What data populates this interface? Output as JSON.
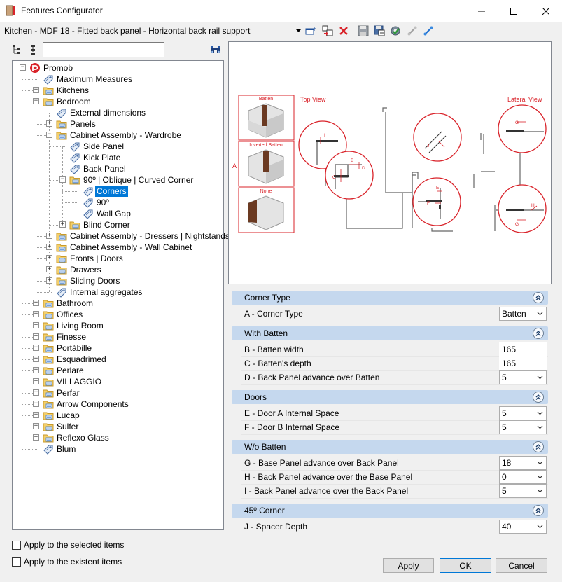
{
  "window": {
    "title": "Features Configurator",
    "controls": {
      "minimize": "minimize",
      "maximize": "maximize",
      "close": "close"
    }
  },
  "toolbar": {
    "configuration": "Kitchen - MDF 18 - Fitted back panel - Horizontal back rail support",
    "buttons": [
      "add-config-icon",
      "copy-config-icon",
      "delete-icon",
      "save-icon",
      "save-as-icon",
      "settings-icon",
      "link-gray-icon",
      "link-blue-icon"
    ]
  },
  "tree_toolbar": {
    "search_value": ""
  },
  "tree": {
    "nodes": [
      {
        "label": "Promob",
        "level": 0,
        "icon": "promob-logo-icon",
        "expander": "-"
      },
      {
        "label": "Maximum Measures",
        "level": 1,
        "icon": "tag-icon",
        "expander": ""
      },
      {
        "label": "Kitchens",
        "level": 1,
        "icon": "folder-icon",
        "expander": "+"
      },
      {
        "label": "Bedroom",
        "level": 1,
        "icon": "folder-icon",
        "expander": "-"
      },
      {
        "label": "External dimensions",
        "level": 2,
        "icon": "tag-icon",
        "expander": ""
      },
      {
        "label": "Panels",
        "level": 2,
        "icon": "folder-icon",
        "expander": "+"
      },
      {
        "label": "Cabinet Assembly - Wardrobe",
        "level": 2,
        "icon": "folder-icon",
        "expander": "-"
      },
      {
        "label": "Side Panel",
        "level": 3,
        "icon": "tag-icon",
        "expander": ""
      },
      {
        "label": " Kick Plate",
        "level": 3,
        "icon": "tag-icon",
        "expander": ""
      },
      {
        "label": "Back Panel",
        "level": 3,
        "icon": "tag-icon",
        "expander": ""
      },
      {
        "label": "90º | Oblique | Curved Corner",
        "level": 3,
        "icon": "folder-icon",
        "expander": "-"
      },
      {
        "label": "Corners",
        "level": 4,
        "icon": "tag-icon",
        "expander": "",
        "selected": true
      },
      {
        "label": "90º",
        "level": 4,
        "icon": "tag-icon",
        "expander": ""
      },
      {
        "label": "Wall Gap",
        "level": 4,
        "icon": "tag-icon",
        "expander": ""
      },
      {
        "label": "Blind Corner",
        "level": 3,
        "icon": "folder-icon",
        "expander": "+"
      },
      {
        "label": "Cabinet Assembly - Dressers | Nightstands",
        "level": 2,
        "icon": "folder-icon",
        "expander": "+"
      },
      {
        "label": "Cabinet Assembly - Wall Cabinet",
        "level": 2,
        "icon": "folder-icon",
        "expander": "+"
      },
      {
        "label": "Fronts | Doors",
        "level": 2,
        "icon": "folder-icon",
        "expander": "+"
      },
      {
        "label": "Drawers",
        "level": 2,
        "icon": "folder-icon",
        "expander": "+"
      },
      {
        "label": "Sliding Doors",
        "level": 2,
        "icon": "folder-icon",
        "expander": "+"
      },
      {
        "label": "Internal aggregates",
        "level": 2,
        "icon": "tag-icon",
        "expander": ""
      },
      {
        "label": "Bathroom",
        "level": 1,
        "icon": "folder-icon",
        "expander": "+"
      },
      {
        "label": "Offices",
        "level": 1,
        "icon": "folder-icon",
        "expander": "+"
      },
      {
        "label": "Living Room",
        "level": 1,
        "icon": "folder-icon",
        "expander": "+"
      },
      {
        "label": "Finesse",
        "level": 1,
        "icon": "folder-icon",
        "expander": "+"
      },
      {
        "label": "Portábille",
        "level": 1,
        "icon": "folder-icon",
        "expander": "+"
      },
      {
        "label": "Esquadrimed",
        "level": 1,
        "icon": "folder-icon",
        "expander": "+"
      },
      {
        "label": "Perlare",
        "level": 1,
        "icon": "folder-icon",
        "expander": "+"
      },
      {
        "label": "VILLAGGIO",
        "level": 1,
        "icon": "folder-icon",
        "expander": "+"
      },
      {
        "label": "Perfar",
        "level": 1,
        "icon": "folder-icon",
        "expander": "+"
      },
      {
        "label": "Arrow Components",
        "level": 1,
        "icon": "folder-icon",
        "expander": "+"
      },
      {
        "label": "Lucap",
        "level": 1,
        "icon": "folder-icon",
        "expander": "+"
      },
      {
        "label": "Sulfer",
        "level": 1,
        "icon": "folder-icon",
        "expander": "+"
      },
      {
        "label": "Reflexo Glass",
        "level": 1,
        "icon": "folder-icon",
        "expander": "+"
      },
      {
        "label": "Blum",
        "level": 1,
        "icon": "tag-icon",
        "expander": ""
      }
    ]
  },
  "preview": {
    "label_a": "A",
    "top_view": "Top View",
    "lateral_view": "Lateral View",
    "thumbs": [
      "Batten",
      "Inverted Batten",
      "None"
    ],
    "markers": {
      "b": "B",
      "c": "C",
      "d": "D",
      "e": "E",
      "f": "F",
      "g": "G",
      "h": "H",
      "i": "I",
      "j": "J"
    }
  },
  "properties": {
    "categories": [
      {
        "name": "Corner Type",
        "items": [
          {
            "label": "A - Corner Type",
            "value": "Batten",
            "dropdown": true
          }
        ]
      },
      {
        "name": "With Batten",
        "items": [
          {
            "label": "B - Batten width",
            "value": "165",
            "dropdown": false
          },
          {
            "label": "C - Batten's depth",
            "value": "165",
            "dropdown": false
          },
          {
            "label": "D - Back Panel advance over Batten",
            "value": "5",
            "dropdown": true
          }
        ]
      },
      {
        "name": "Doors",
        "items": [
          {
            "label": "E - Door A Internal Space",
            "value": "5",
            "dropdown": true
          },
          {
            "label": "F - Door B Internal Space",
            "value": "5",
            "dropdown": true
          }
        ]
      },
      {
        "name": "W/o Batten",
        "items": [
          {
            "label": "G - Base Panel advance over Back Panel",
            "value": "18",
            "dropdown": true
          },
          {
            "label": "H - Back Panel advance over the Base Panel",
            "value": "0",
            "dropdown": true
          },
          {
            "label": "I - Back Panel advance over the Back Panel",
            "value": "5",
            "dropdown": true
          }
        ]
      },
      {
        "name": "45º Corner",
        "items": [
          {
            "label": "J - Spacer Depth",
            "value": "40",
            "dropdown": true
          }
        ]
      }
    ]
  },
  "options": {
    "apply_selected": "Apply to the selected items",
    "apply_existent": "Apply to the existent items"
  },
  "buttons": {
    "apply": "Apply",
    "ok": "OK",
    "cancel": "Cancel"
  },
  "colors": {
    "accent": "#0078d7",
    "diagram_red": "#d9232a",
    "category_bg": "#c5d8ee"
  }
}
